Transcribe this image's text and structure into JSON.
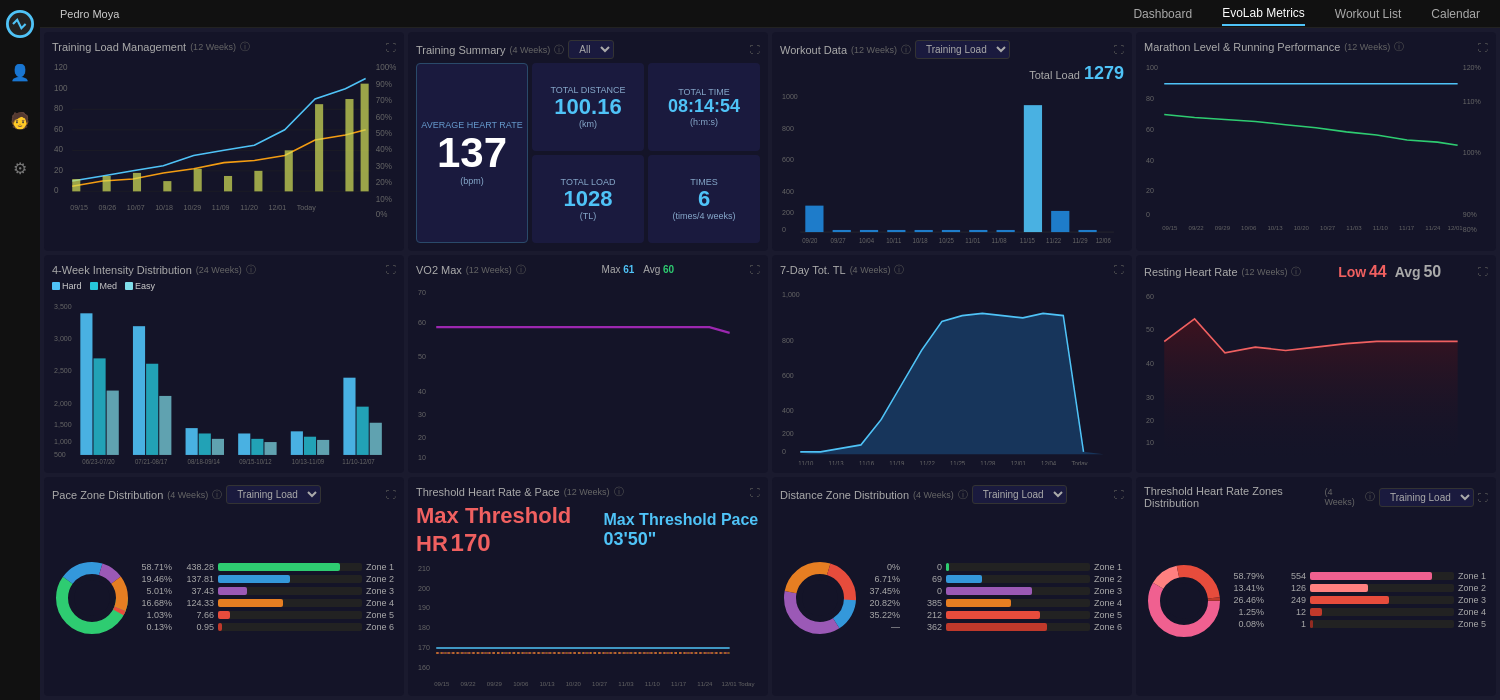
{
  "user": {
    "name": "Pedro Moya"
  },
  "nav": {
    "items": [
      "Dashboard",
      "EvoLab Metrics",
      "Workout List",
      "Calendar"
    ],
    "active": "EvoLab Metrics"
  },
  "cards": {
    "training_load": {
      "title": "Training Load Management",
      "weeks": "12 Weeks"
    },
    "training_summary": {
      "title": "Training Summary",
      "weeks": "4 Weeks",
      "filter": "All",
      "total_distance": {
        "label": "Total Distance",
        "value": "100.16",
        "unit": "(km)"
      },
      "total_time": {
        "label": "Total Time",
        "value": "08:14:54",
        "unit": "(h:m:s)"
      },
      "avg_hr": {
        "label": "Average Heart Rate",
        "value": "137",
        "unit": "(bpm)"
      },
      "total_load": {
        "label": "Total Load",
        "value": "1028",
        "unit": "(TL)"
      },
      "times": {
        "label": "Times",
        "value": "6",
        "unit": "(times/4 weeks)"
      }
    },
    "workout_data": {
      "title": "Workout Data",
      "weeks": "12 Weeks",
      "filter": "Training Load",
      "total_load_label": "Total Load",
      "total_load_value": "1279"
    },
    "marathon": {
      "title": "Marathon Level & Running Performance",
      "weeks": "12 Weeks"
    },
    "intensity_dist": {
      "title": "4-Week Intensity Distribution",
      "weeks": "24 Weeks",
      "legend": [
        "Hard",
        "Med",
        "Easy"
      ]
    },
    "vo2max": {
      "title": "VO2 Max",
      "weeks": "12 Weeks",
      "max_label": "Max",
      "max_value": "61",
      "avg_label": "Avg",
      "avg_value": "60"
    },
    "seven_day": {
      "title": "7-Day Tot. TL",
      "weeks": "4 Weeks"
    },
    "resting_hr": {
      "title": "Resting Heart Rate",
      "weeks": "12 Weeks",
      "low_label": "Low",
      "low_value": "44",
      "avg_label": "Avg",
      "avg_value": "50"
    },
    "pace_zone": {
      "title": "Pace Zone Distribution",
      "weeks": "4 Weeks",
      "filter": "Training Load",
      "zones": [
        {
          "pct": "58.71%",
          "val": "438.28",
          "label": "Zone 1",
          "color": "#2ecc71",
          "width": 85
        },
        {
          "pct": "19.46%",
          "val": "137.81",
          "label": "Zone 2",
          "color": "#3498db",
          "width": 50
        },
        {
          "pct": "5.01%",
          "val": "37.43",
          "label": "Zone 3",
          "color": "#9b59b6",
          "width": 20
        },
        {
          "pct": "16.68%",
          "val": "124.33",
          "label": "Zone 4",
          "color": "#e67e22",
          "width": 45
        },
        {
          "pct": "1.03%",
          "val": "7.66",
          "label": "Zone 5",
          "color": "#e74c3c",
          "width": 8
        },
        {
          "pct": "0.13%",
          "val": "0.95",
          "label": "Zone 6",
          "color": "#c0392b",
          "width": 3
        }
      ]
    },
    "threshold_hr_pace": {
      "title": "Threshold Heart Rate & Pace",
      "weeks": "12 Weeks",
      "max_hr_label": "Max Threshold HR",
      "max_hr_value": "170",
      "max_pace_label": "Max Threshold Pace",
      "max_pace_value": "03'50\""
    },
    "distance_zone": {
      "title": "Distance Zone Distribution",
      "weeks": "4 Weeks",
      "filter": "Training Load",
      "zones": [
        {
          "pct": "0%",
          "val": "0",
          "label": "Zone 1",
          "color": "#2ecc71",
          "width": 2
        },
        {
          "pct": "6.71%",
          "val": "69",
          "label": "Zone 2",
          "color": "#3498db",
          "width": 25
        },
        {
          "pct": "37.45%",
          "val": "0",
          "label": "Zone 3",
          "color": "#9b59b6",
          "width": 60
        },
        {
          "pct": "20.82%",
          "val": "385",
          "label": "Zone 4",
          "color": "#e67e22",
          "width": 45
        },
        {
          "pct": "35.22%",
          "val": "212",
          "label": "Zone 5",
          "color": "#e74c3c",
          "width": 65
        },
        {
          "pct": "—",
          "val": "362",
          "label": "Zone 6",
          "color": "#c0392b",
          "width": 70
        }
      ]
    },
    "threshold_zones": {
      "title": "Threshold Heart Rate Zones Distribution",
      "weeks": "4 Weeks",
      "filter": "Training Load",
      "zones": [
        {
          "pct": "58.79%",
          "val": "554",
          "label": "Zone 1",
          "color": "#2ecc71",
          "width": 85
        },
        {
          "pct": "13.41%",
          "val": "126",
          "label": "Zone 2",
          "color": "#3498db",
          "width": 40
        },
        {
          "pct": "26.46%",
          "val": "249",
          "label": "Zone 3",
          "color": "#9b59b6",
          "width": 55
        },
        {
          "pct": "1.25%",
          "val": "12",
          "label": "Zone 4",
          "color": "#e67e22",
          "width": 8
        },
        {
          "pct": "0.08%",
          "val": "1",
          "label": "Zone 5",
          "color": "#e74c3c",
          "width": 3
        }
      ]
    }
  },
  "x_axis_dates": {
    "tlm": [
      "09/15",
      "09/26",
      "10/07",
      "10/18",
      "10/29",
      "11/09",
      "11/20",
      "12/01 Today"
    ],
    "workout": [
      "09/20",
      "09/27",
      "10/04",
      "10/11",
      "10/18",
      "10/25",
      "11/01",
      "11/08",
      "11/15",
      "11/22",
      "11/29",
      "12/06"
    ],
    "marathon": [
      "09/15",
      "09/22",
      "09/29",
      "10/06",
      "10/13",
      "10/20",
      "10/27",
      "11/03",
      "11/10",
      "11/17",
      "11/24",
      "12/01 Today"
    ],
    "intensity": [
      "06/23-07/20",
      "07/21-08/17",
      "08/18-09/14",
      "09/15-10/12",
      "10/13-11/09",
      "11/10-12/07"
    ],
    "vo2": [
      "09/15",
      "09/22",
      "09/29",
      "10/06",
      "10/13",
      "10/20",
      "10/27",
      "11/03",
      "11/10",
      "11/17",
      "11/24",
      "12/01 Today"
    ],
    "seven_day": [
      "11/10",
      "11/13",
      "11/16",
      "11/19",
      "11/22",
      "11/25",
      "11/28",
      "12/01",
      "12/04",
      "Today"
    ],
    "resting": [
      "09/15",
      "09/22",
      "09/29",
      "10/06",
      "10/13",
      "10/20",
      "10/27",
      "11/03",
      "11/10",
      "11/17",
      "11/24",
      "12/01 Today"
    ],
    "threshold": [
      "09/15",
      "09/22",
      "09/29",
      "10/06",
      "10/13",
      "10/20",
      "10/27",
      "11/03",
      "11/10",
      "11/17",
      "11/24",
      "12/01 Today"
    ]
  }
}
